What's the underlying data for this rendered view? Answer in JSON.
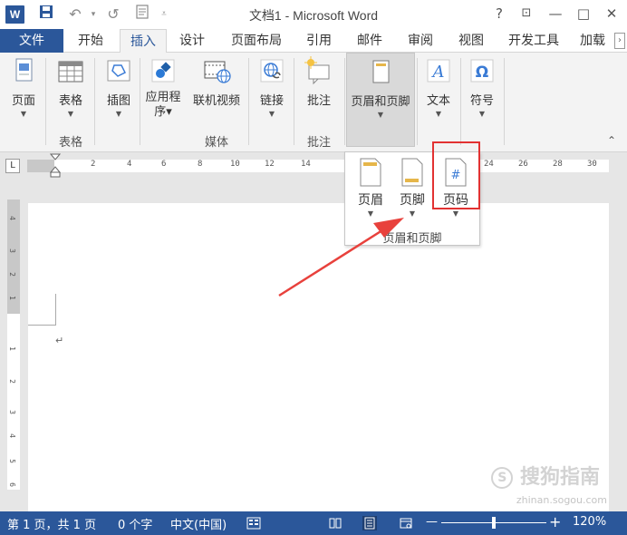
{
  "titlebar": {
    "title": "文档1 - Microsoft Word",
    "app_icon": "W",
    "help": "?",
    "restore_ribbon": "⊡",
    "minimize": "—",
    "maximize": "□",
    "close": "✕"
  },
  "tabs": {
    "file": "文件",
    "items": [
      "开始",
      "插入",
      "设计",
      "页面布局",
      "引用",
      "邮件",
      "审阅",
      "视图",
      "开发工具",
      "加载"
    ],
    "active": "插入"
  },
  "ribbon": {
    "page": "页面",
    "table": "表格",
    "table_group": "表格",
    "illustrations": "插图",
    "apps": "应用程序序",
    "online_video": "联机视频",
    "media_group": "媒体",
    "links": "链接",
    "comment": "批注",
    "comment_group": "批注",
    "header_footer": "页眉和页脚",
    "text": "文本",
    "symbols": "符号"
  },
  "ruler": {
    "h_numbers": [
      "2",
      "4",
      "6",
      "8",
      "10",
      "12",
      "14",
      "24",
      "26",
      "28",
      "30"
    ],
    "v_numbers": [
      "4",
      "3",
      "2",
      "1",
      "1",
      "2",
      "3",
      "4",
      "5",
      "6"
    ]
  },
  "dropdown": {
    "header": "页眉",
    "footer": "页脚",
    "page_number": "页码",
    "page_number_glyph": "#",
    "group_label": "页眉和页脚"
  },
  "statusbar": {
    "page_info": "第 1 页，共 1 页",
    "word_count": "0 个字",
    "language": "中文(中国)",
    "zoom_minus": "—",
    "zoom_plus": "+",
    "zoom_level": "120%"
  },
  "watermark": {
    "brand": "搜狗指南",
    "url": "zhinan.sogou.com"
  },
  "colors": {
    "accent": "#2b579a",
    "highlight": "#e23232",
    "arrow": "#e8413c"
  }
}
